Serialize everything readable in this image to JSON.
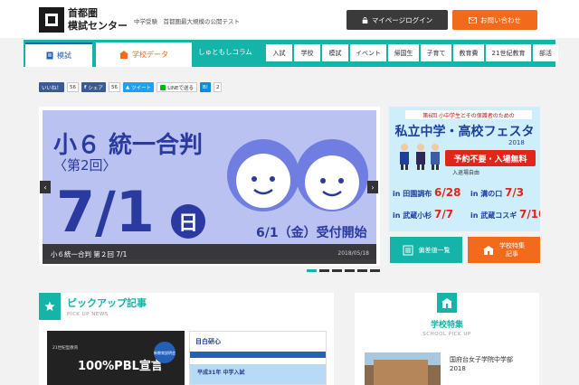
{
  "header": {
    "logo_line1": "首都圏",
    "logo_line2": "模試センター",
    "tagline": "中学受験　首都圏最大規模の公開テスト",
    "login_label": "マイページログイン",
    "contact_label": "お問い合わせ"
  },
  "nav": {
    "tabs": [
      {
        "label": "模試"
      },
      {
        "label": "学校データ"
      }
    ],
    "category_label": "しゅともしコラム",
    "categories": [
      "入試",
      "学校",
      "模試",
      "イベント",
      "帰国生",
      "子育て",
      "教育費",
      "21世紀教育",
      "部活"
    ]
  },
  "social": {
    "like_label": "いいね！",
    "like_count": "56",
    "share_label": "シェア",
    "share_count": "56",
    "tweet_label": "ツイート",
    "line_label": "LINEで送る",
    "hatena_label": "B!",
    "hatena_count": "2"
  },
  "hero": {
    "headline": "小６ 統一合判",
    "subhead": "〈第2回〉",
    "big_date": "7/1",
    "day_label": "日",
    "start_label": "6/1（金）受付開始",
    "caption_title": "小６統一合判 第２回 7/1",
    "caption_date": "2018/05/18"
  },
  "side_banner": {
    "top_line": "第6回 小中学生とその保護者のための",
    "title": "私立中学・高校フェスタ",
    "year": "2018",
    "red_label": "予約不要・入場無料",
    "free_label": "入退場自由",
    "rows": [
      {
        "place": "in 田園調布",
        "num": "6/28"
      },
      {
        "place": "in 溝の口",
        "num": "7/3"
      },
      {
        "place": "in 武蔵小杉",
        "num": "7/7"
      },
      {
        "place": "in 武蔵コスギ",
        "num": "7/10"
      }
    ]
  },
  "side_buttons": {
    "hensachi_label": "偏差値一覧",
    "tokushu_label1": "学校特集",
    "tokushu_label2": "記事"
  },
  "pickup": {
    "title": "ピックアップ記事",
    "subtitle": "PICK UP NEWS",
    "thumb1_text": "100%PBL宣言",
    "thumb1_tiny": "21世紀型教育",
    "thumb1_badge": "新教育説明会",
    "thumb2_head": "目白研心",
    "thumb2_text": "平成31年 中学入試"
  },
  "school_pickup": {
    "title": "学校特集",
    "subtitle": "SCHOOL PICK UP",
    "name_line1": "国府台女子学院中学部",
    "name_line2": "2018"
  },
  "colors": {
    "accent": "#14b4a8",
    "orange": "#f26a1b",
    "dark": "#3a3a3a",
    "blue": "#2360b8"
  }
}
